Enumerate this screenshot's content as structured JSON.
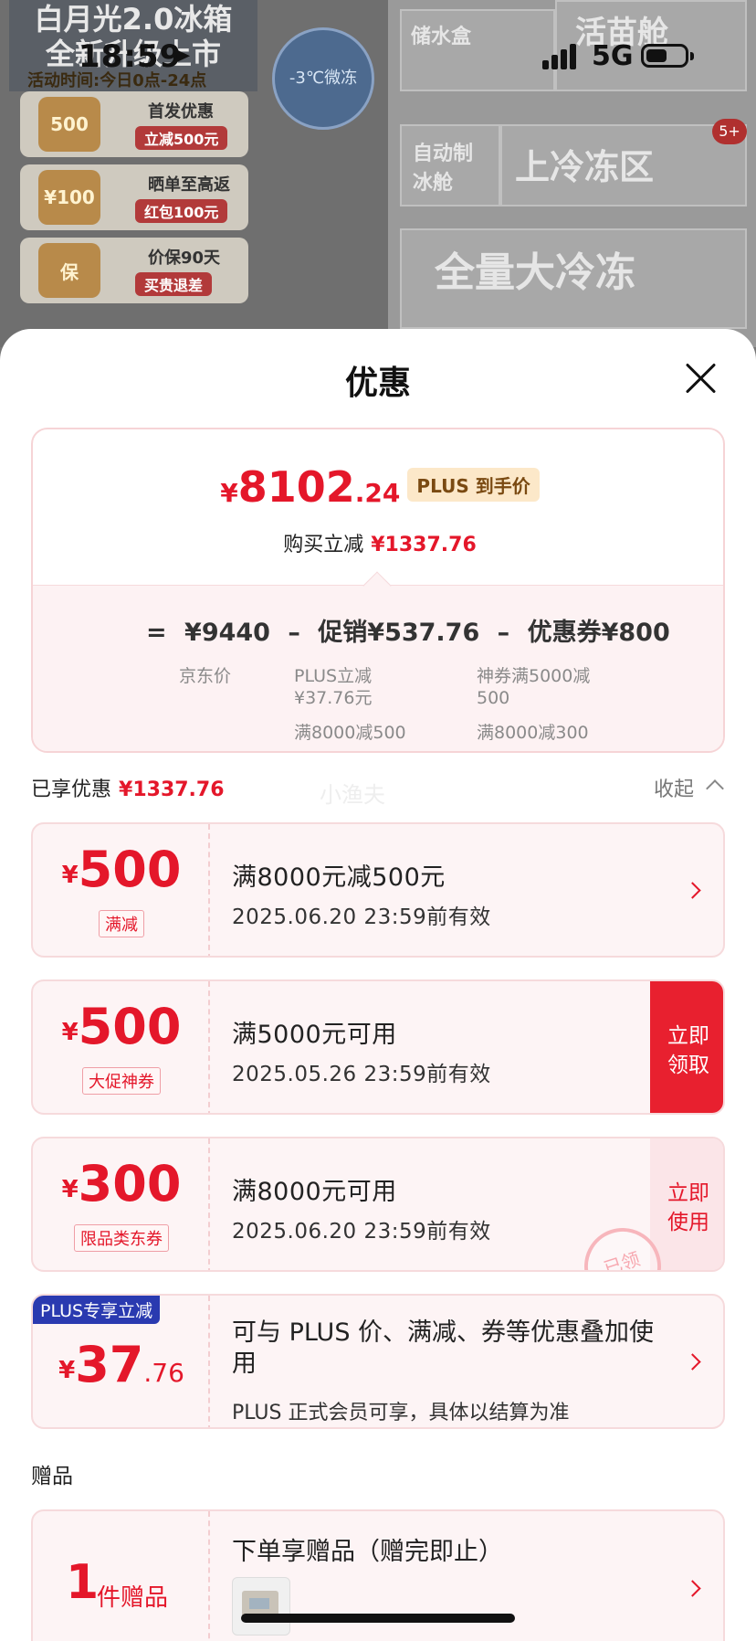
{
  "status_bar": {
    "time": "18:59",
    "network": "5G"
  },
  "background": {
    "headline": "白月光2.0冰箱\n全新升级上市",
    "activity_time": "活动时间:今日0点-24点",
    "cards": [
      {
        "icon": "500",
        "title": "首发优惠",
        "tag": "立减500元"
      },
      {
        "icon": "¥100",
        "title": "晒单至高返",
        "tag": "红包100元"
      },
      {
        "icon": "保",
        "title": "价保90天",
        "tag": "买贵退差"
      }
    ],
    "badge_circle": "-3℃微冻",
    "shelf_labels": [
      "储水盒",
      "活苗舱",
      "自动制冰舱",
      "上冷冻区",
      "全量大冷冻"
    ],
    "cart_badge": "5+"
  },
  "sheet": {
    "title": "优惠",
    "summary": {
      "symbol": "¥",
      "price_int": "8102",
      "price_dec": ".24",
      "plus_tag": "PLUS 到手价",
      "reduce_label": "购买立减",
      "reduce_value": "¥1337.76",
      "calc": {
        "eq": "=",
        "jd_price": "¥9440",
        "minus1": "–",
        "promo": "促销¥537.76",
        "minus2": "–",
        "coupon": "优惠券¥800"
      },
      "jd_label": "京东价",
      "promo_items": [
        "PLUS立减\n¥37.76元",
        "满8000减500"
      ],
      "coupon_items": [
        "神券满5000减\n500",
        "满8000减300"
      ]
    },
    "enjoyed": {
      "label": "已享优惠",
      "value": "¥1337.76",
      "collapse": "收起",
      "watermark": "小渔夫"
    },
    "coupons": [
      {
        "symbol": "¥",
        "amount": "500",
        "tag": "满减",
        "title": "满8000元减500元",
        "date": "2025.06.20 23:59前有效"
      },
      {
        "symbol": "¥",
        "amount": "500",
        "tag": "大促神券",
        "title": "满5000元可用",
        "date": "2025.05.26 23:59前有效",
        "button": "立即\n领取"
      },
      {
        "symbol": "¥",
        "amount": "300",
        "tag": "限品类东券",
        "title": "满8000元可用",
        "date": "2025.06.20 23:59前有效",
        "button": "立即\n使用",
        "stamp": "已领"
      }
    ],
    "plus": {
      "label": "PLUS专享立减",
      "symbol": "¥",
      "amount": "37",
      "decimal": ".76",
      "title": "可与 PLUS 价、满减、券等优惠叠加使用",
      "desc": "PLUS 正式会员可享，具体以结算为准"
    },
    "gift": {
      "heading": "赠品",
      "count": "1",
      "unit": "件赠品",
      "title": "下单享赠品（赠完即止）"
    }
  },
  "colors": {
    "accent": "#e4172a",
    "plus_blue": "#2a3ab0",
    "card_bg": "#fdf4f5"
  }
}
